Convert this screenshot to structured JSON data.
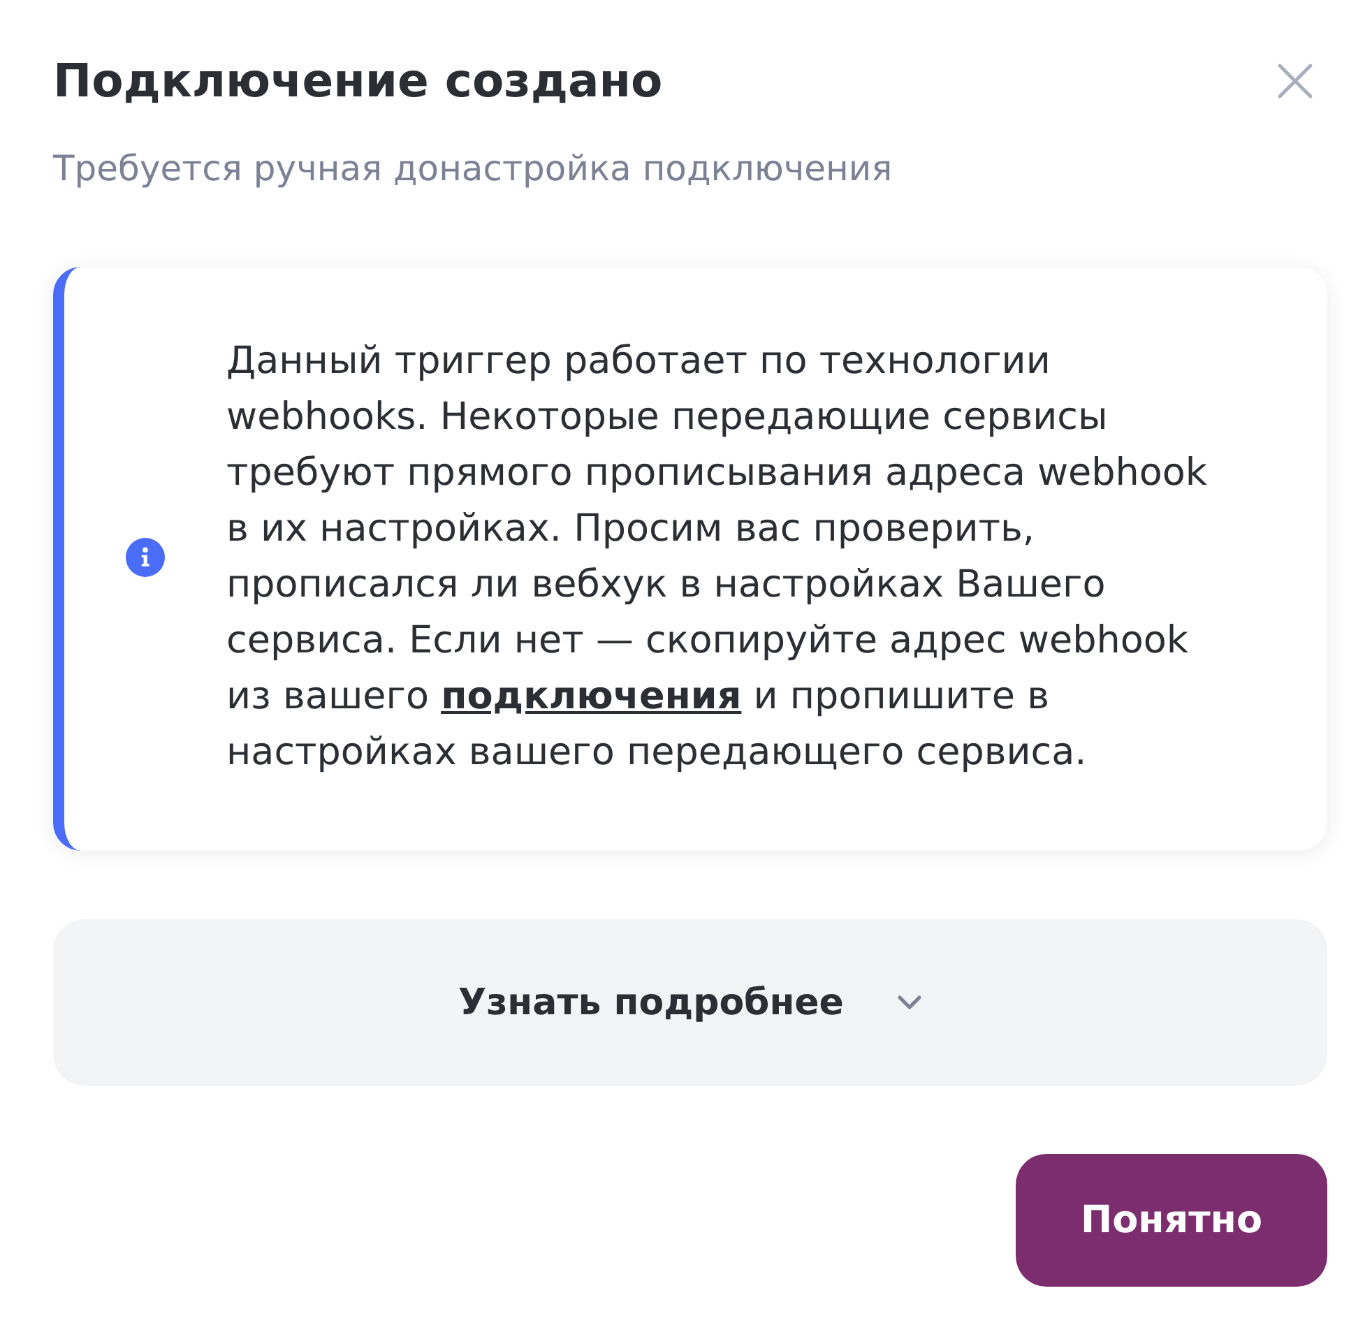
{
  "dialog": {
    "title": "Подключение создано",
    "subtitle": "Требуется ручная донастройка подключения"
  },
  "notice": {
    "kind": "info",
    "text_before": "Данный триггер работает по технологии webhooks. Некоторые передающие сервисы требуют прямого прописывания адреса webhook в их настройках. Просим вас проверить, прописался ли вебхук в настройках Вашего сервиса. Если нет — скопируйте адрес webhook из вашего ",
    "link": "подключения",
    "text_after": " и пропишите в настройках вашего передающего сервиса."
  },
  "details": {
    "label": "Узнать подробнее",
    "expanded": false
  },
  "buttons": [
    {
      "label": "Понятно",
      "kind": "primary"
    }
  ]
}
